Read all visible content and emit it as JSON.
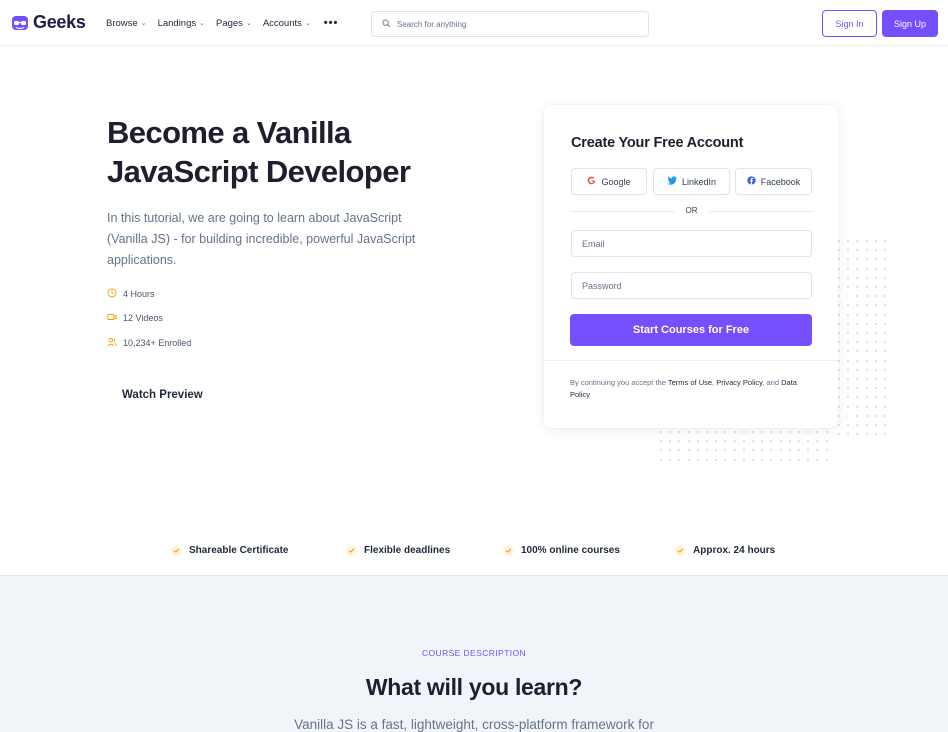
{
  "brand": {
    "name": "Geeks",
    "accent": "#754ffe"
  },
  "nav": {
    "items": [
      {
        "label": "Browse",
        "icon": "chevron-down-icon"
      },
      {
        "label": "Landings",
        "icon": "chevron-down-icon"
      },
      {
        "label": "Pages",
        "icon": "chevron-down-icon"
      },
      {
        "label": "Accounts",
        "icon": "chevron-down-icon"
      }
    ],
    "more_label": "•••",
    "search_placeholder": "Search for anything",
    "signin_label": "Sign In",
    "signup_label": "Sign Up"
  },
  "hero": {
    "title": "Become a Vanilla JavaScript Developer",
    "description": "In this tutorial, we are going to learn about JavaScript (Vanilla JS) - for building incredible, powerful JavaScript applications.",
    "meta": [
      {
        "icon": "clock-icon",
        "text": "4 Hours"
      },
      {
        "icon": "video-icon",
        "text": "12 Videos"
      },
      {
        "icon": "users-icon",
        "text": "10,234+ Enrolled"
      }
    ],
    "watch_label": "Watch Preview"
  },
  "signup_card": {
    "title": "Create Your Free Account",
    "social": [
      {
        "label": "Google",
        "icon": "google-icon"
      },
      {
        "label": "LinkedIn",
        "icon": "linkedin-icon"
      },
      {
        "label": "Facebook",
        "icon": "facebook-icon"
      }
    ],
    "or_label": "OR",
    "email_placeholder": "Email",
    "password_placeholder": "Password",
    "cta_label": "Start Courses for Free",
    "terms_prefix": "By continuing you accept the ",
    "terms_link1": "Terms of Use",
    "terms_sep": ", ",
    "terms_link2": "Privacy Policy",
    "terms_and": ", and ",
    "terms_link3": "Data Policy"
  },
  "features": [
    {
      "label": "Shareable Certificate",
      "icon": "check-icon"
    },
    {
      "label": "Flexible deadlines",
      "icon": "check-icon"
    },
    {
      "label": "100% online courses",
      "icon": "check-icon"
    },
    {
      "label": "Approx. 24 hours",
      "icon": "check-icon"
    }
  ],
  "course_section": {
    "eyebrow": "COURSE DESCRIPTION",
    "title": "What will you learn?",
    "subtitle": "Vanilla JS is a fast, lightweight, cross-platform framework for"
  }
}
